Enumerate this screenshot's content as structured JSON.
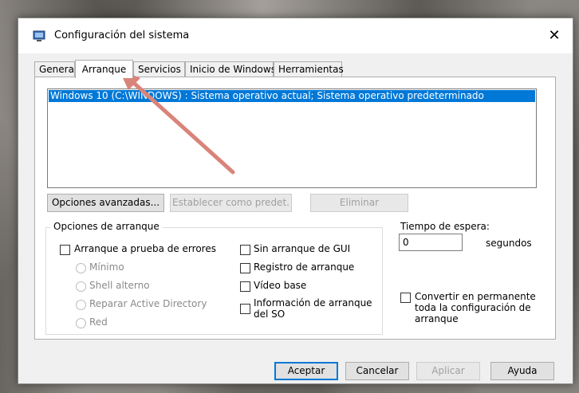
{
  "window": {
    "title": "Configuración del sistema",
    "close_label": "✕"
  },
  "tabs": [
    {
      "label": "General"
    },
    {
      "label": "Arranque",
      "active": true
    },
    {
      "label": "Servicios"
    },
    {
      "label": "Inicio de Windows"
    },
    {
      "label": "Herramientas"
    }
  ],
  "os_list": {
    "items": [
      "Windows 10 (C:\\WINDOWS) : Sistema operativo actual; Sistema operativo predeterminado"
    ],
    "selected_index": 0
  },
  "os_buttons": {
    "advanced": "Opciones avanzadas...",
    "set_default": "Establecer como predet.",
    "delete": "Eliminar"
  },
  "boot_options": {
    "title": "Opciones de arranque",
    "safe_boot": {
      "label": "Arranque a prueba de errores",
      "checked": false
    },
    "radios": [
      {
        "label": "Mínimo"
      },
      {
        "label": "Shell alterno"
      },
      {
        "label": "Reparar Active Directory"
      },
      {
        "label": "Red"
      }
    ],
    "no_gui": {
      "label": "Sin arranque de GUI",
      "checked": false
    },
    "boot_log": {
      "label": "Registro de arranque",
      "checked": false
    },
    "base_video": {
      "label": "Vídeo base",
      "checked": false
    },
    "os_boot_info": {
      "label": "Información de arranque del SO",
      "checked": false
    }
  },
  "timeout": {
    "label": "Tiempo de espera:",
    "value": "0",
    "unit": "segundos"
  },
  "make_permanent": {
    "label": "Convertir en permanente toda la configuración de arranque",
    "checked": false
  },
  "footer": {
    "ok": "Aceptar",
    "cancel": "Cancelar",
    "apply": "Aplicar",
    "help": "Ayuda"
  },
  "colors": {
    "selection": "#0078d7",
    "annotation_arrow": "#d9847a"
  }
}
